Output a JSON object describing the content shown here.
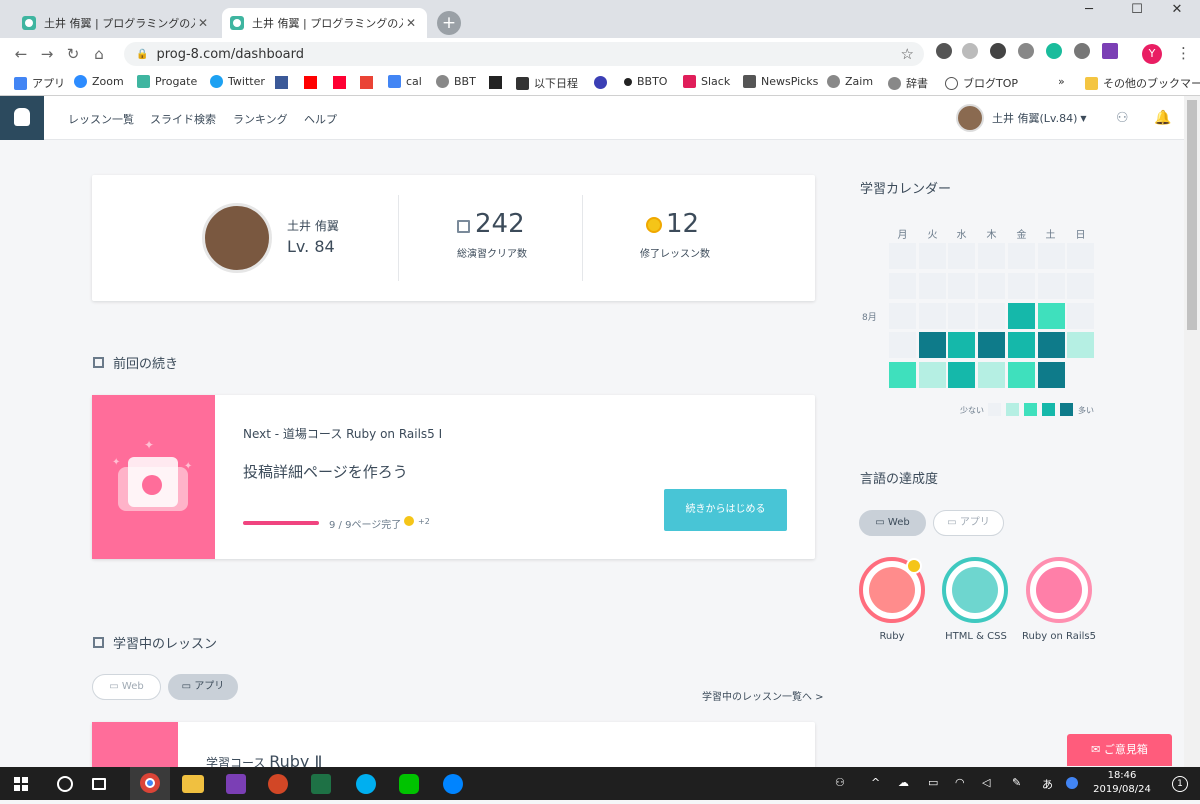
{
  "browser": {
    "tabs": [
      {
        "title": "土井 侑翼 | プログラミングの入門なら"
      },
      {
        "title": "土井 侑翼 | プログラミングの入門なら"
      }
    ],
    "url": "prog-8.com/dashboard",
    "profile_initial": "Y",
    "bookmarks": [
      "アプリ",
      "Zoom",
      "Progate",
      "Twitter",
      "cal",
      "BBT",
      "以下日程",
      "BBTO",
      "Slack",
      "NewsPicks",
      "Zaim",
      "辞書",
      "ブログTOP"
    ],
    "bookmark_more": "»",
    "other_bookmarks": "その他のブックマーク",
    "controls": {
      "minimize": "─",
      "maximize": "☐",
      "close": "✕",
      "back": "←",
      "forward": "→",
      "reload": "↻",
      "home": "⌂",
      "star": "☆"
    }
  },
  "site": {
    "nav": [
      "レッスン一覧",
      "スライド検索",
      "ランキング",
      "ヘルプ"
    ],
    "user_menu": "土井 侑翼(Lv.84)",
    "profile": {
      "name": "土井 侑翼",
      "level": "Lv. 84",
      "exercises_count": "242",
      "exercises_label": "総演習クリア数",
      "lessons_count": "12",
      "lessons_label": "修了レッスン数"
    },
    "continue": {
      "section_title": "前回の続き",
      "next": "Next - 道場コース Ruby on Rails5 Ⅰ",
      "lesson_title": "投稿詳細ページを作ろう",
      "progress_fraction": 1.0,
      "progress_text": "9 / 9ページ完了",
      "medal_bonus": "+2",
      "button": "続きからはじめる"
    },
    "learning": {
      "section_title": "学習中のレッスン",
      "tabs": [
        "Web",
        "アプリ"
      ],
      "link": "学習中のレッスン一覧へ >",
      "lesson_prefix": "学習コース",
      "lesson_name": "Ruby Ⅱ"
    },
    "calendar": {
      "title": "学習カレンダー",
      "days": [
        "月",
        "火",
        "水",
        "木",
        "金",
        "土",
        "日"
      ],
      "month": "8月",
      "legend_less": "少ない",
      "legend_more": "多い",
      "levels": [
        [
          0,
          0,
          0,
          0,
          0,
          0,
          0
        ],
        [
          0,
          0,
          0,
          0,
          0,
          0,
          0
        ],
        [
          0,
          0,
          0,
          0,
          3,
          2,
          0
        ],
        [
          0,
          4,
          3,
          4,
          3,
          4,
          1
        ],
        [
          2,
          1,
          3,
          1,
          2,
          4,
          null
        ]
      ],
      "colors": [
        "#eef1f5",
        "#b5efe3",
        "#3fe0bd",
        "#15b8aa",
        "#0e7b8a"
      ]
    },
    "achievement": {
      "title": "言語の達成度",
      "tabs": [
        "Web",
        "アプリ"
      ],
      "languages": [
        "Ruby",
        "HTML & CSS",
        "Ruby on Rails5"
      ]
    },
    "feedback_button": "ご意見箱"
  },
  "taskbar": {
    "time": "18:46",
    "date": "2019/08/24",
    "ime": "あ",
    "notif_count": "1"
  }
}
